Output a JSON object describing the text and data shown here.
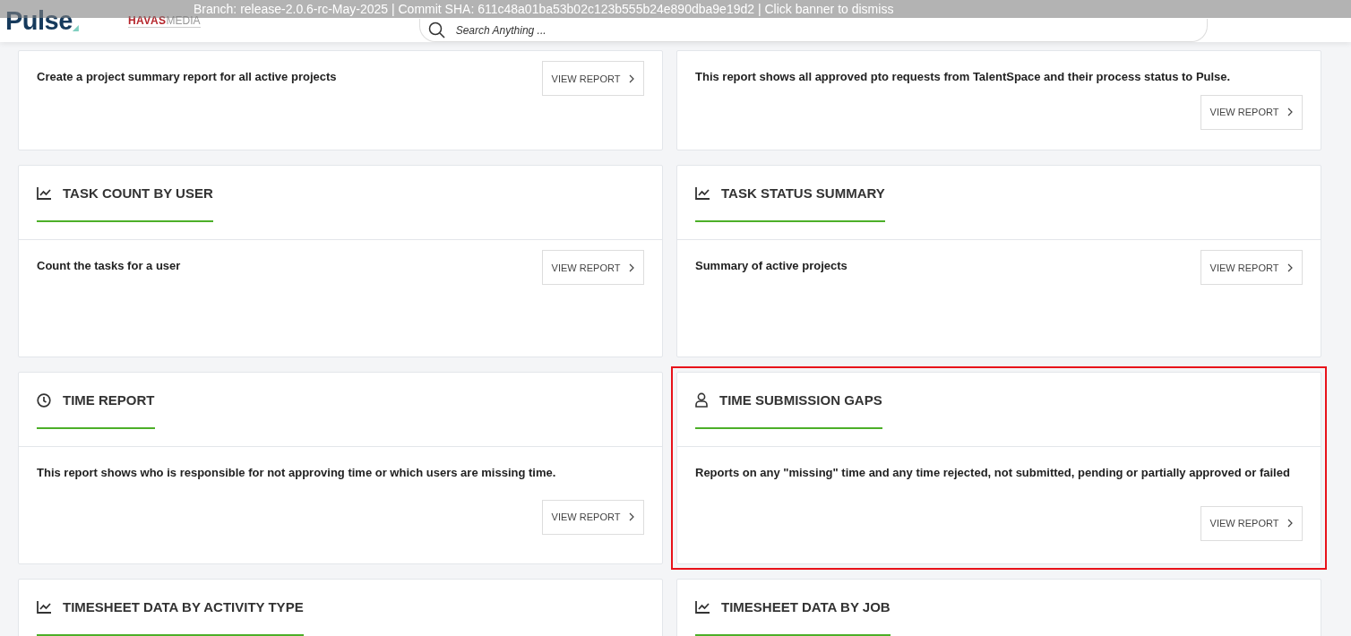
{
  "header": {
    "logo": "Pulse",
    "brand": "HAVAS",
    "brand_suffix": "MEDIA",
    "search": {
      "placeholder": "Search Anything ..."
    },
    "banner": "Branch: release-2.0.6-rc-May-2025 | Commit SHA: 611c48a01ba53b02c123b555b24e890dba9e19d2 | Click banner to dismiss"
  },
  "cards": [
    {
      "description": "Create a project summary report for all active projects",
      "button": "VIEW REPORT",
      "highlighted": false
    },
    {
      "description": "This report shows all approved pto requests from TalentSpace and their process status to Pulse.",
      "button": "VIEW REPORT",
      "highlighted": false
    },
    {
      "kind": "chart",
      "title": "TASK COUNT BY USER",
      "description": "Count the tasks for a user",
      "button": "VIEW REPORT",
      "highlighted": false
    },
    {
      "kind": "chart",
      "title": "TASK STATUS SUMMARY",
      "description": "Summary of active projects",
      "button": "VIEW REPORT",
      "highlighted": false
    },
    {
      "kind": "clock",
      "title": "TIME REPORT",
      "description": "This report shows who is responsible for not approving time or which users are missing time.",
      "button": "VIEW REPORT",
      "highlighted": false
    },
    {
      "kind": "person",
      "title": "TIME SUBMISSION GAPS",
      "description": "Reports on any \"missing\" time and any time rejected, not submitted, pending or partially approved or failed",
      "button": "VIEW REPORT",
      "highlighted": true
    },
    {
      "kind": "chart",
      "title": "TIMESHEET DATA BY ACTIVITY TYPE"
    },
    {
      "kind": "chart",
      "title": "TIMESHEET DATA BY JOB"
    }
  ]
}
